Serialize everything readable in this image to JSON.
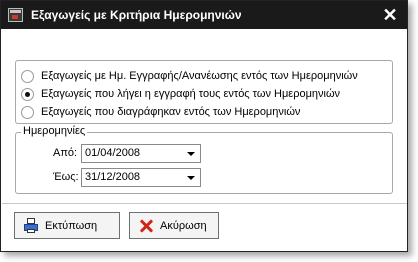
{
  "window": {
    "title": "Εξαγωγείς με Κριτήρια Ημερομηνιών",
    "close_glyph": "✕"
  },
  "options": [
    {
      "label": "Εξαγωγείς με Ημ. Εγγραφής/Ανανέωσης εντός των Ημερομηνιών",
      "checked": false
    },
    {
      "label": "Εξαγωγείς που λήγει η εγγραφή τους  εντός των Ημερομηνιών",
      "checked": true
    },
    {
      "label": "Εξαγωγείς που διαγράφηκαν εντός των Ημερομηνιών",
      "checked": false
    }
  ],
  "dates": {
    "group_label": "Ημερομηνίες",
    "from_label": "Από:",
    "from_value": "01/04/2008",
    "to_label": "Έως:",
    "to_value": "31/12/2008"
  },
  "buttons": {
    "print_label": "Εκτύπωση",
    "cancel_label": "Ακύρωση"
  },
  "icons": {
    "window": "app-window-icon",
    "print": "printer-icon",
    "cancel": "red-x-icon",
    "dropdown": "chevron-down-icon"
  }
}
